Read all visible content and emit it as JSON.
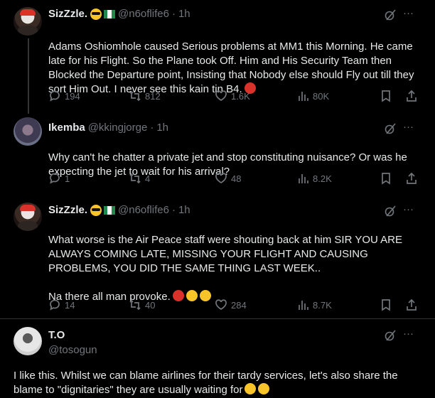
{
  "tweets": [
    {
      "name": "SizZzle.",
      "handle": "@n6oflife6",
      "sep": "·",
      "time": "1h",
      "text": "Adams Oshiomhole caused Serious problems at MM1 this Morning. He came late for his Flight. So the Plane took Off. Him and His Security Team then Blocked the Departure point, Insisting that Nobody else should Fly out till they sort Him Out. I never see this kain tin B4.",
      "stats": {
        "replies": "194",
        "reposts": "812",
        "likes": "1.6K",
        "views": "80K"
      }
    },
    {
      "name": "Ikemba",
      "handle": "@kkingjorge",
      "sep": "·",
      "time": "1h",
      "text": "Why can't he chatter a private jet and stop constituting nuisance? Or was he expecting the jet to wait for his arrival?",
      "stats": {
        "replies": "1",
        "reposts": "4",
        "likes": "48",
        "views": "8.2K"
      }
    },
    {
      "name": "SizZzle.",
      "handle": "@n6oflife6",
      "sep": "·",
      "time": "1h",
      "text": "What worse is the Air Peace staff were shouting back at him SIR YOU ARE ALWAYS COMING LATE, MISSING YOUR FLIGHT AND CAUSING PROBLEMS, YOU DID THE SAME THING LAST WEEK..\n\nNa there all man provoke.",
      "stats": {
        "replies": "14",
        "reposts": "40",
        "likes": "284",
        "views": "8.7K"
      }
    },
    {
      "name": "T.O",
      "handle": "@tosogun",
      "text": "I like this. Whilst we can blame airlines for their tardy services,  let's also share the blame to \"dignitaries\" they are usually waiting for"
    }
  ],
  "more_label": "···",
  "colors": {
    "background": "#000000",
    "text": "#e7e9ea",
    "muted": "#71767b",
    "divider": "#2f3336"
  },
  "icons": [
    "grok-icon",
    "more-icon",
    "reply-icon",
    "repost-icon",
    "like-icon",
    "views-icon",
    "bookmark-icon",
    "share-icon"
  ]
}
